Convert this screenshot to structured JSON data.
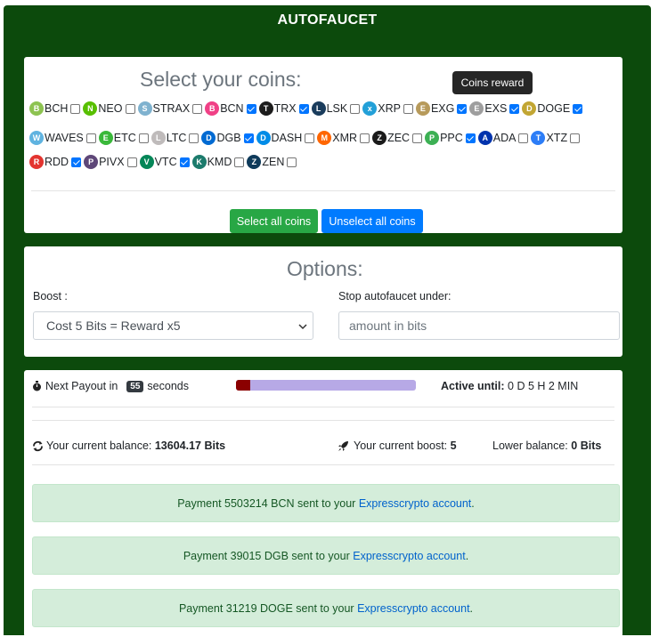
{
  "header": {
    "title": "AUTOFAUCET"
  },
  "coins_section": {
    "title": "Select your coins:",
    "tooltip": "Coins reward",
    "rows": [
      [
        {
          "label": "BCH",
          "checked": false,
          "color": "#8dc351",
          "glyph": "B"
        },
        {
          "label": "NEO",
          "checked": false,
          "color": "#58bf00",
          "glyph": "N"
        },
        {
          "label": "STRAX",
          "checked": false,
          "color": "#7fb2cf",
          "glyph": "S"
        },
        {
          "label": "BCN",
          "checked": true,
          "color": "#f04086",
          "glyph": "B"
        },
        {
          "label": "TRX",
          "checked": true,
          "color": "#1c1c1c",
          "glyph": "T"
        },
        {
          "label": "LSK",
          "checked": false,
          "color": "#1a3c5c",
          "glyph": "L"
        },
        {
          "label": "XRP",
          "checked": false,
          "color": "#23a0d8",
          "glyph": "x"
        },
        {
          "label": "EXG",
          "checked": true,
          "color": "#b79a5b",
          "glyph": "E"
        },
        {
          "label": "EXS",
          "checked": true,
          "color": "#9e9e9e",
          "glyph": "E"
        },
        {
          "label": "DOGE",
          "checked": true,
          "color": "#c2a633",
          "glyph": "D"
        }
      ],
      [
        {
          "label": "WAVES",
          "checked": false,
          "color": "#5fb3e0",
          "glyph": "W"
        },
        {
          "label": "ETC",
          "checked": false,
          "color": "#3ab83a",
          "glyph": "E"
        },
        {
          "label": "LTC",
          "checked": false,
          "color": "#bfbbbb",
          "glyph": "L"
        },
        {
          "label": "DGB",
          "checked": true,
          "color": "#006ad2",
          "glyph": "D"
        },
        {
          "label": "DASH",
          "checked": false,
          "color": "#008ce7",
          "glyph": "D"
        },
        {
          "label": "XMR",
          "checked": false,
          "color": "#ff6600",
          "glyph": "M"
        },
        {
          "label": "ZEC",
          "checked": false,
          "color": "#1a1a1a",
          "glyph": "Z"
        },
        {
          "label": "PPC",
          "checked": true,
          "color": "#3cb054",
          "glyph": "P"
        },
        {
          "label": "ADA",
          "checked": false,
          "color": "#0033ad",
          "glyph": "A"
        },
        {
          "label": "XTZ",
          "checked": false,
          "color": "#2c7df7",
          "glyph": "T"
        }
      ],
      [
        {
          "label": "RDD",
          "checked": true,
          "color": "#e3342f",
          "glyph": "R"
        },
        {
          "label": "PIVX",
          "checked": false,
          "color": "#5e4778",
          "glyph": "P"
        },
        {
          "label": "VTC",
          "checked": true,
          "color": "#048657",
          "glyph": "V"
        },
        {
          "label": "KMD",
          "checked": false,
          "color": "#1c7b6c",
          "glyph": "K"
        },
        {
          "label": "ZEN",
          "checked": false,
          "color": "#0e3a5a",
          "glyph": "Z"
        }
      ]
    ],
    "select_all_label": "Select all coins",
    "unselect_all_label": "Unselect all coins"
  },
  "options_section": {
    "title": "Options:",
    "boost_label": "Boost :",
    "boost_value": "Cost 5 Bits = Reward x5",
    "stop_label": "Stop autofaucet under:",
    "stop_placeholder": "amount in bits"
  },
  "status": {
    "next_payout_label": "Next Payout in",
    "seconds_value": "55",
    "seconds_label": "seconds",
    "progress_fraction": 0.08,
    "active_until_label": "Active until:",
    "active_until_value": "0 D 5 H 2 MIN",
    "balance_label": "Your current balance:",
    "balance_value": "13604.17 Bits",
    "boost_label": "Your current boost:",
    "boost_value": "5",
    "lower_balance_label": "Lower balance:",
    "lower_balance_value": "0 Bits"
  },
  "payments": [
    {
      "text": "Payment 5503214 BCN sent to your ",
      "link": "Expresscrypto account",
      "end": "."
    },
    {
      "text": "Payment 39015 DGB sent to your ",
      "link": "Expresscrypto account",
      "end": "."
    },
    {
      "text": "Payment 31219 DOGE sent to your ",
      "link": "Expresscrypto account",
      "end": "."
    }
  ]
}
